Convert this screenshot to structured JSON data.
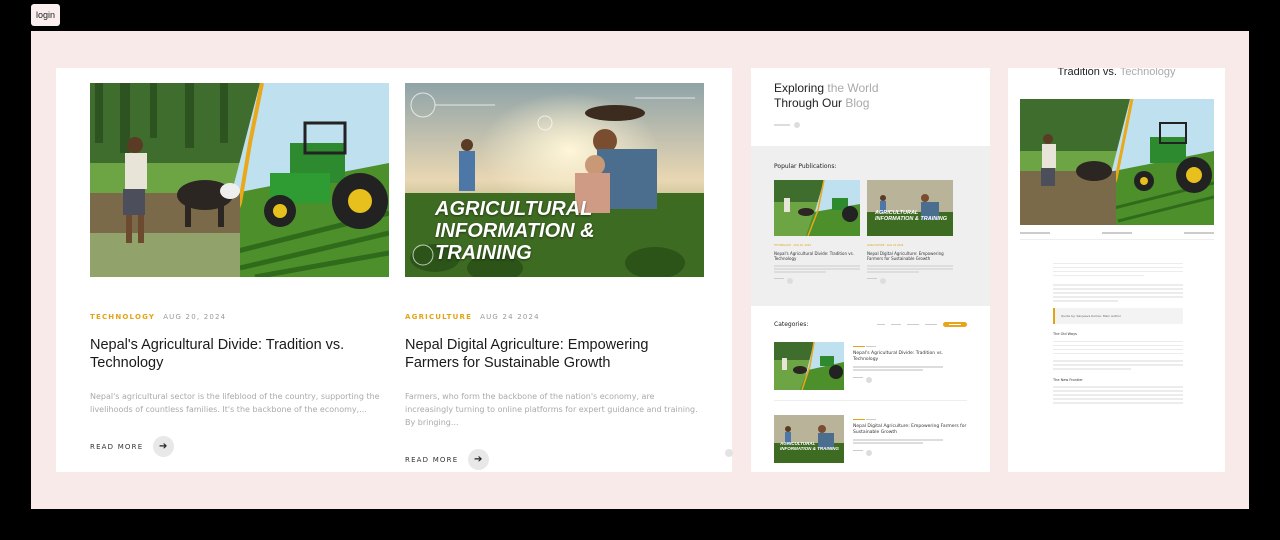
{
  "login_label": "login",
  "posts": [
    {
      "category": "TECHNOLOGY",
      "date": "AUG 20, 2024",
      "title": "Nepal's Agricultural Divide: Tradition vs. Technology",
      "excerpt": "Nepal's agricultural sector is the lifeblood of the country, supporting the livelihoods of countless families. It's the backbone of the economy,...",
      "read_more": "READ MORE"
    },
    {
      "category": "AGRICULTURE",
      "date": "AUG 24 2024",
      "title": "Nepal Digital Agriculture: Empowering Farmers for Sustainable Growth",
      "excerpt": "Farmers, who form the backbone of the nation's economy, are increasingly turning to online platforms for expert guidance and training. By bringing...",
      "read_more": "READ MORE",
      "image_text": "AGRICULTURAL INFORMATION & TRAINING"
    }
  ],
  "mid": {
    "hero_title_dark1": "Exploring",
    "hero_title_light1": " the World",
    "hero_title_dark2": "Through Our",
    "hero_title_light2": " Blog",
    "popular_title": "Popular Publications:",
    "popular": [
      {
        "meta": "TECHNOLOGY · AUG 20, 2024",
        "title": "Nepal's Agricultural Divide: Tradition vs. Technology"
      },
      {
        "meta": "AGRICULTURE · AUG 24 2024",
        "title": "Nepal Digital Agriculture: Empowering Farmers for Sustainable Growth",
        "image_text": "AGRICULTURAL INFORMATION & TRAINING"
      }
    ],
    "categories_title": "Categories:",
    "categories_rows": [
      {
        "title": "Nepal's Agricultural Divide: Tradition vs. Technology"
      },
      {
        "title": "Nepal Digital Agriculture: Empowering Farmers for Sustainable Growth",
        "image_text": "AGRICULTURAL INFORMATION & TRAINING"
      }
    ]
  },
  "right": {
    "title_dark": "Tradition vs.",
    "title_light": " Technology",
    "quote": "Quote by: Sanjeeva Kumar, Main Author",
    "sub1": "The Old Ways",
    "sub2": "The New Frontier"
  },
  "colors": {
    "accent": "#e2a417",
    "frame_bg": "#f7eae9"
  }
}
